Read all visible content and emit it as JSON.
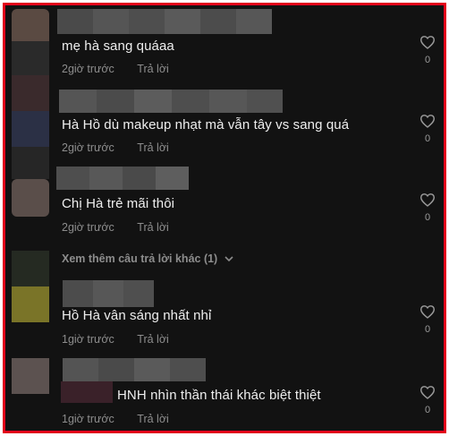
{
  "comments": [
    {
      "text": "mẹ hà sang quáaa",
      "time": "2giờ trước",
      "reply": "Trả lời",
      "likes": "0"
    },
    {
      "text": "Hà Hồ dù makeup nhạt mà vẫn tây vs sang quá",
      "time": "2giờ trước",
      "reply": "Trả lời",
      "likes": "0"
    },
    {
      "text": "Chị Hà trẻ mãi thôi",
      "time": "2giờ trước",
      "reply": "Trả lời",
      "likes": "0"
    },
    {
      "text": "Hồ Hà vân sáng nhất nhỉ",
      "time": "1giờ trước",
      "reply": "Trả lời",
      "likes": "0"
    },
    {
      "text": "HNH nhìn thần thái khác biệt thiệt",
      "time": "1giờ trước",
      "reply": "Trả lời",
      "likes": "0"
    }
  ],
  "more_replies": "Xem thêm câu trả lời khác (1)",
  "colors": {
    "background": "#121212",
    "border": "#e3001b",
    "text": "#eeeeee",
    "meta": "#8d8d8d"
  },
  "icons": {
    "like": "heart-outline-icon",
    "expand": "chevron-down-icon"
  }
}
